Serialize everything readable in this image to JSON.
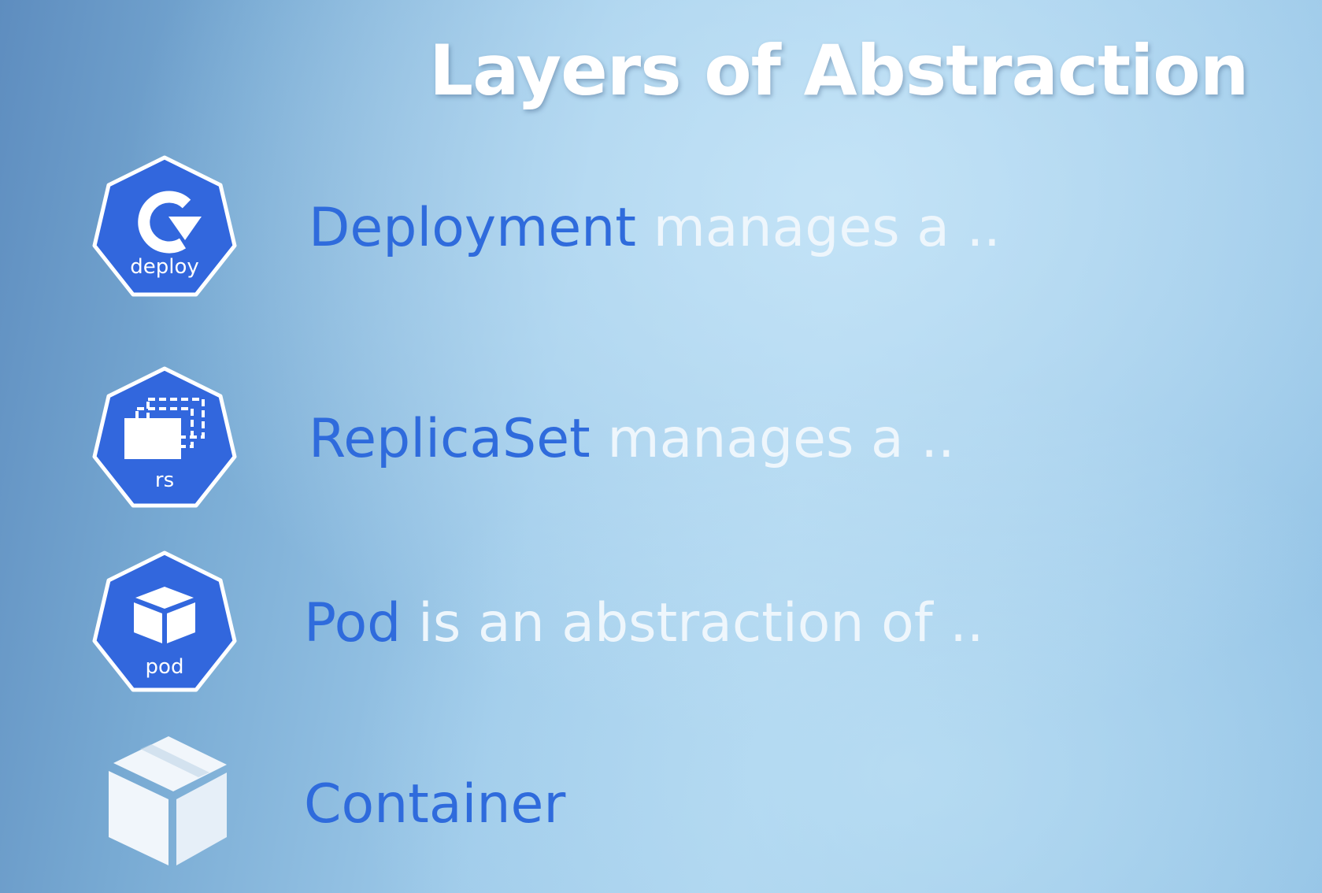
{
  "slide": {
    "title": "Layers of Abstraction",
    "colors": {
      "accent": "#2f6bdc",
      "body_text": "#eef6fc",
      "icon_fill": "#3267dd",
      "icon_border": "#ffffff",
      "container_icon": "#f1f6fb"
    },
    "rows": [
      {
        "icon": "deploy-heptagon-icon",
        "icon_label": "deploy",
        "keyword": "Deployment",
        "rest": "manages a .."
      },
      {
        "icon": "replicaset-heptagon-icon",
        "icon_label": "rs",
        "keyword": "ReplicaSet",
        "rest": "manages a .."
      },
      {
        "icon": "pod-heptagon-icon",
        "icon_label": "pod",
        "keyword": "Pod",
        "rest": "is an abstraction of .."
      },
      {
        "icon": "container-box-icon",
        "keyword": "Container",
        "rest": ""
      }
    ]
  }
}
